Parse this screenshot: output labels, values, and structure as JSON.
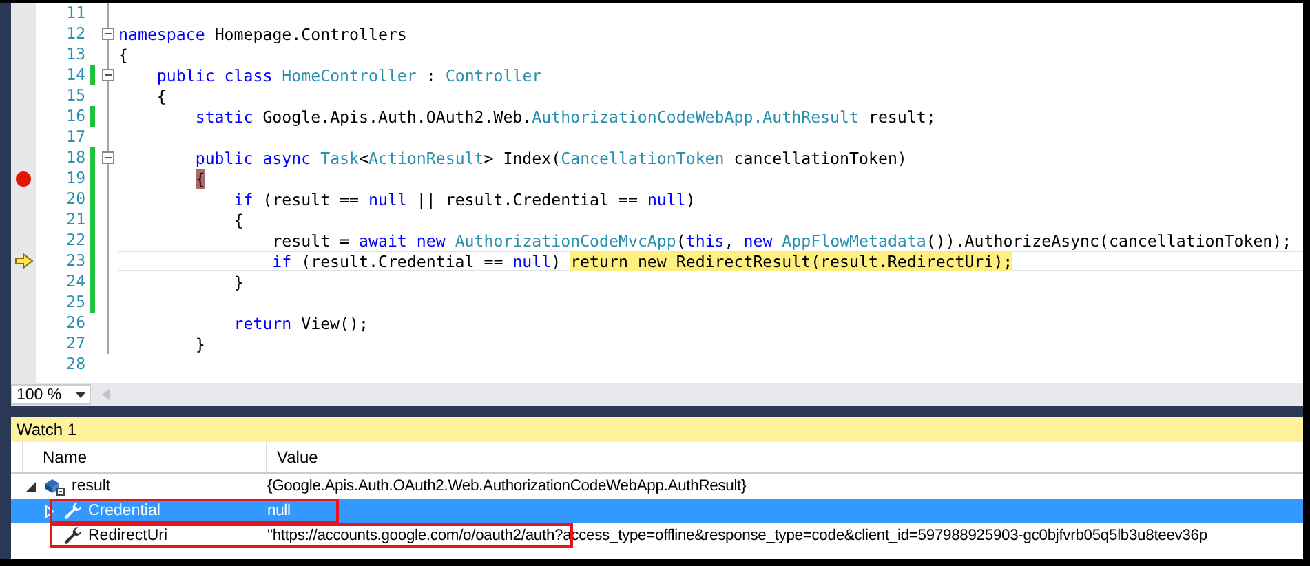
{
  "editor": {
    "lines": [
      {
        "number": "11",
        "changed": false,
        "collapsible": false,
        "breakpoint": false,
        "current": false
      },
      {
        "number": "12",
        "changed": false,
        "collapsible": true,
        "breakpoint": false,
        "current": false,
        "tokens": [
          {
            "text": "namespace ",
            "kind": "keyword"
          },
          {
            "text": "Homepage.Controllers",
            "kind": "plain"
          }
        ]
      },
      {
        "number": "13",
        "changed": false,
        "collapsible": false,
        "breakpoint": false,
        "current": false,
        "tokens": [
          {
            "text": "{",
            "kind": "plain"
          }
        ]
      },
      {
        "number": "14",
        "changed": true,
        "collapsible": true,
        "breakpoint": false,
        "current": false,
        "tokens": [
          {
            "text": "    public class ",
            "kind": "keyword"
          },
          {
            "text": "HomeController",
            "kind": "type"
          },
          {
            "text": " : ",
            "kind": "plain"
          },
          {
            "text": "Controller",
            "kind": "type"
          }
        ]
      },
      {
        "number": "15",
        "changed": false,
        "collapsible": false,
        "breakpoint": false,
        "current": false,
        "tokens": [
          {
            "text": "    {",
            "kind": "plain"
          }
        ]
      },
      {
        "number": "16",
        "changed": true,
        "collapsible": false,
        "breakpoint": false,
        "current": false,
        "tokens": [
          {
            "text": "        static ",
            "kind": "keyword"
          },
          {
            "text": "Google.Apis.Auth.OAuth2.Web.",
            "kind": "plain"
          },
          {
            "text": "AuthorizationCodeWebApp.AuthResult",
            "kind": "type"
          },
          {
            "text": " result;",
            "kind": "plain"
          }
        ]
      },
      {
        "number": "17",
        "changed": false,
        "collapsible": false,
        "breakpoint": false,
        "current": false
      },
      {
        "number": "18",
        "changed": true,
        "collapsible": true,
        "breakpoint": false,
        "current": false,
        "tokens": [
          {
            "text": "        public async ",
            "kind": "keyword"
          },
          {
            "text": "Task",
            "kind": "type"
          },
          {
            "text": "<",
            "kind": "plain"
          },
          {
            "text": "ActionResult",
            "kind": "type"
          },
          {
            "text": "> Index(",
            "kind": "plain"
          },
          {
            "text": "CancellationToken",
            "kind": "type"
          },
          {
            "text": " cancellationToken)",
            "kind": "plain"
          }
        ]
      },
      {
        "number": "19",
        "changed": true,
        "collapsible": false,
        "breakpoint": true,
        "current": false,
        "tokens": [
          {
            "text": "        {",
            "kind": "breakpoint"
          }
        ]
      },
      {
        "number": "20",
        "changed": true,
        "collapsible": false,
        "breakpoint": false,
        "current": false,
        "tokens": [
          {
            "text": "            if",
            "kind": "keyword"
          },
          {
            "text": " (result == ",
            "kind": "plain"
          },
          {
            "text": "null",
            "kind": "keyword"
          },
          {
            "text": " || result.Credential == ",
            "kind": "plain"
          },
          {
            "text": "null",
            "kind": "keyword"
          },
          {
            "text": ")",
            "kind": "plain"
          }
        ]
      },
      {
        "number": "21",
        "changed": true,
        "collapsible": false,
        "breakpoint": false,
        "current": false,
        "tokens": [
          {
            "text": "            {",
            "kind": "plain"
          }
        ]
      },
      {
        "number": "22",
        "changed": true,
        "collapsible": false,
        "breakpoint": false,
        "current": false,
        "tokens": [
          {
            "text": "                result = ",
            "kind": "plain"
          },
          {
            "text": "await new ",
            "kind": "keyword"
          },
          {
            "text": "AuthorizationCodeMvcApp",
            "kind": "type"
          },
          {
            "text": "(",
            "kind": "plain"
          },
          {
            "text": "this",
            "kind": "keyword"
          },
          {
            "text": ", ",
            "kind": "plain"
          },
          {
            "text": "new ",
            "kind": "keyword"
          },
          {
            "text": "AppFlowMetadata",
            "kind": "type"
          },
          {
            "text": "()).AuthorizeAsync(cancellationToken);",
            "kind": "plain"
          }
        ]
      },
      {
        "number": "23",
        "changed": true,
        "collapsible": false,
        "breakpoint": false,
        "current": true,
        "tokens": [
          {
            "text": "                if",
            "kind": "keyword"
          },
          {
            "text": " (result.Credential == ",
            "kind": "plain"
          },
          {
            "text": "null",
            "kind": "keyword"
          },
          {
            "text": ") ",
            "kind": "plain"
          },
          {
            "text": "return new RedirectResult(result.RedirectUri);",
            "kind": "statement"
          }
        ]
      },
      {
        "number": "24",
        "changed": true,
        "collapsible": false,
        "breakpoint": false,
        "current": false,
        "tokens": [
          {
            "text": "            }",
            "kind": "plain"
          }
        ]
      },
      {
        "number": "25",
        "changed": true,
        "collapsible": false,
        "breakpoint": false,
        "current": false
      },
      {
        "number": "26",
        "changed": false,
        "collapsible": false,
        "breakpoint": false,
        "current": false,
        "tokens": [
          {
            "text": "            return",
            "kind": "keyword"
          },
          {
            "text": " View();",
            "kind": "plain"
          }
        ]
      },
      {
        "number": "27",
        "changed": false,
        "collapsible": false,
        "breakpoint": false,
        "current": false,
        "tokens": [
          {
            "text": "        }",
            "kind": "plain"
          }
        ]
      },
      {
        "number": "28",
        "changed": false,
        "collapsible": false,
        "breakpoint": false,
        "current": false
      }
    ],
    "zoom": "100 %"
  },
  "watch": {
    "title": "Watch 1",
    "columns": [
      "Name",
      "Value"
    ],
    "rows": [
      {
        "name": "result",
        "value": "{Google.Apis.Auth.OAuth2.Web.AuthorizationCodeWebApp.AuthResult}",
        "kind": "variable",
        "expanded": true,
        "selected": false,
        "marked": false,
        "children": [
          {
            "name": "Credential",
            "value": "null",
            "kind": "property",
            "expanded": false,
            "selected": true,
            "marked": true
          },
          {
            "name": "RedirectUri",
            "value": "\"https://accounts.google.com/o/oauth2/auth?access_type=offline&response_type=code&client_id=597988925903-gc0bjfvrb05q5lb3u8teev36p",
            "kind": "property",
            "selected": false,
            "marked": true
          }
        ]
      }
    ]
  }
}
